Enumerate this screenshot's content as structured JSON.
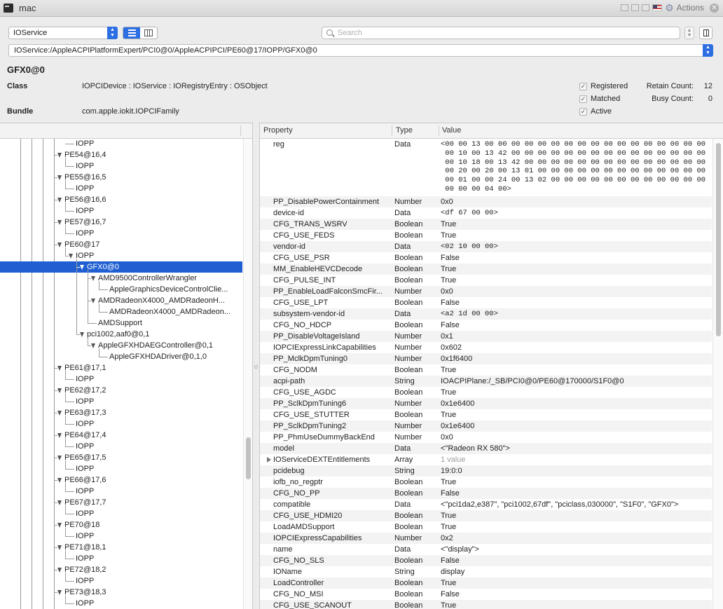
{
  "window": {
    "title": "mac",
    "actions_label": "Actions"
  },
  "toolbar": {
    "class_value": "IOService",
    "search_placeholder": "Search",
    "path": "IOService:/AppleACPIPlatformExpert/PCI0@0/AppleACPIPCI/PE60@17/IOPP/GFX0@0"
  },
  "entry": {
    "name": "GFX0@0",
    "class_label": "Class",
    "class_value": "IOPCIDevice : IOService : IORegistryEntry : OSObject",
    "bundle_label": "Bundle",
    "bundle_value": "com.apple.iokit.IOPCIFamily",
    "flags": [
      {
        "label": "Registered",
        "checked": true
      },
      {
        "label": "Matched",
        "checked": true
      },
      {
        "label": "Active",
        "checked": true
      }
    ],
    "retain_count_label": "Retain Count:",
    "retain_count": "12",
    "busy_count_label": "Busy Count:",
    "busy_count": "0"
  },
  "tree": {
    "rows": [
      {
        "label": "IOPP",
        "level": 5,
        "tri": false
      },
      {
        "label": "PE54@16,4",
        "level": 4,
        "tri": true
      },
      {
        "label": "IOPP",
        "level": 5,
        "tri": false
      },
      {
        "label": "PE55@16,5",
        "level": 4,
        "tri": true
      },
      {
        "label": "IOPP",
        "level": 5,
        "tri": false
      },
      {
        "label": "PE56@16,6",
        "level": 4,
        "tri": true
      },
      {
        "label": "IOPP",
        "level": 5,
        "tri": false
      },
      {
        "label": "PE57@16,7",
        "level": 4,
        "tri": true
      },
      {
        "label": "IOPP",
        "level": 5,
        "tri": false
      },
      {
        "label": "PE60@17",
        "level": 4,
        "tri": true
      },
      {
        "label": "IOPP",
        "level": 5,
        "tri": true
      },
      {
        "label": "GFX0@0",
        "level": 6,
        "tri": true,
        "selected": true
      },
      {
        "label": "AMD9500ControllerWrangler",
        "level": 7,
        "tri": true
      },
      {
        "label": "AppleGraphicsDeviceControlClie...",
        "level": 8,
        "tri": false
      },
      {
        "label": "AMDRadeonX4000_AMDRadeonH...",
        "level": 7,
        "tri": true
      },
      {
        "label": "AMDRadeonX4000_AMDRadeon...",
        "level": 8,
        "tri": false
      },
      {
        "label": "AMDSupport",
        "level": 7,
        "tri": false
      },
      {
        "label": "pci1002,aaf0@0,1",
        "level": 6,
        "tri": true
      },
      {
        "label": "AppleGFXHDAEGController@0,1",
        "level": 7,
        "tri": true
      },
      {
        "label": "AppleGFXHDADriver@0,1,0",
        "level": 8,
        "tri": false
      },
      {
        "label": "PE61@17,1",
        "level": 4,
        "tri": true
      },
      {
        "label": "IOPP",
        "level": 5,
        "tri": false
      },
      {
        "label": "PE62@17,2",
        "level": 4,
        "tri": true
      },
      {
        "label": "IOPP",
        "level": 5,
        "tri": false
      },
      {
        "label": "PE63@17,3",
        "level": 4,
        "tri": true
      },
      {
        "label": "IOPP",
        "level": 5,
        "tri": false
      },
      {
        "label": "PE64@17,4",
        "level": 4,
        "tri": true
      },
      {
        "label": "IOPP",
        "level": 5,
        "tri": false
      },
      {
        "label": "PE65@17,5",
        "level": 4,
        "tri": true
      },
      {
        "label": "IOPP",
        "level": 5,
        "tri": false
      },
      {
        "label": "PE66@17,6",
        "level": 4,
        "tri": true
      },
      {
        "label": "IOPP",
        "level": 5,
        "tri": false
      },
      {
        "label": "PE67@17,7",
        "level": 4,
        "tri": true
      },
      {
        "label": "IOPP",
        "level": 5,
        "tri": false
      },
      {
        "label": "PE70@18",
        "level": 4,
        "tri": true
      },
      {
        "label": "IOPP",
        "level": 5,
        "tri": false
      },
      {
        "label": "PE71@18,1",
        "level": 4,
        "tri": true
      },
      {
        "label": "IOPP",
        "level": 5,
        "tri": false
      },
      {
        "label": "PE72@18,2",
        "level": 4,
        "tri": true
      },
      {
        "label": "IOPP",
        "level": 5,
        "tri": false
      },
      {
        "label": "PE73@18,3",
        "level": 4,
        "tri": true
      },
      {
        "label": "IOPP",
        "level": 5,
        "tri": false
      }
    ]
  },
  "properties": {
    "headers": {
      "property": "Property",
      "type": "Type",
      "value": "Value"
    },
    "reg": {
      "key": "reg",
      "type": "Data",
      "value": "<00 00 13 00 00 00 00 00 00 00 00 00 00 00 00 00 00 00 00 00\n 00 10 00 13 42 00 00 00 00 00 00 00 00 00 00 00 00 00 00 00\n 00 10 18 00 13 42 00 00 00 00 00 00 00 00 00 00 00 00 00 00\n 00 20 00 20 00 13 01 00 00 00 00 00 00 00 00 00 00 00 00 00\n 00 01 00 00 24 00 13 02 00 00 00 00 00 00 00 00 00 00 00 00\n 00 00 00 04 00>"
    },
    "rows": [
      {
        "key": "PP_DisablePowerContainment",
        "type": "Number",
        "value": "0x0"
      },
      {
        "key": "device-id",
        "type": "Data",
        "value": "<df 67 00 00>",
        "mono": true
      },
      {
        "key": "CFG_TRANS_WSRV",
        "type": "Boolean",
        "value": "True"
      },
      {
        "key": "CFG_USE_FEDS",
        "type": "Boolean",
        "value": "True"
      },
      {
        "key": "vendor-id",
        "type": "Data",
        "value": "<02 10 00 00>",
        "mono": true
      },
      {
        "key": "CFG_USE_PSR",
        "type": "Boolean",
        "value": "False"
      },
      {
        "key": "MM_EnableHEVCDecode",
        "type": "Boolean",
        "value": "True"
      },
      {
        "key": "CFG_PULSE_INT",
        "type": "Boolean",
        "value": "True"
      },
      {
        "key": "PP_EnableLoadFalconSmcFir...",
        "type": "Number",
        "value": "0x0"
      },
      {
        "key": "CFG_USE_LPT",
        "type": "Boolean",
        "value": "False"
      },
      {
        "key": "subsystem-vendor-id",
        "type": "Data",
        "value": "<a2 1d 00 00>",
        "mono": true
      },
      {
        "key": "CFG_NO_HDCP",
        "type": "Boolean",
        "value": "False"
      },
      {
        "key": "PP_DisableVoltageIsland",
        "type": "Number",
        "value": "0x1"
      },
      {
        "key": "IOPCIExpressLinkCapabilities",
        "type": "Number",
        "value": "0x602"
      },
      {
        "key": "PP_MclkDpmTuning0",
        "type": "Number",
        "value": "0x1f6400"
      },
      {
        "key": "CFG_NODM",
        "type": "Boolean",
        "value": "True"
      },
      {
        "key": "acpi-path",
        "type": "String",
        "value": "IOACPIPlane:/_SB/PCI0@0/PE60@170000/S1F0@0"
      },
      {
        "key": "CFG_USE_AGDC",
        "type": "Boolean",
        "value": "True"
      },
      {
        "key": "PP_SclkDpmTuning6",
        "type": "Number",
        "value": "0x1e6400"
      },
      {
        "key": "CFG_USE_STUTTER",
        "type": "Boolean",
        "value": "True"
      },
      {
        "key": "PP_SclkDpmTuning2",
        "type": "Number",
        "value": "0x1e6400"
      },
      {
        "key": "PP_PhmUseDummyBackEnd",
        "type": "Number",
        "value": "0x0"
      },
      {
        "key": "model",
        "type": "Data",
        "value": "<\"Radeon RX 580\">"
      },
      {
        "key": "IOServiceDEXTEntitlements",
        "type": "Array",
        "value": "1 value",
        "dim": true,
        "expand": true
      },
      {
        "key": "pcidebug",
        "type": "String",
        "value": "19:0:0"
      },
      {
        "key": "iofb_no_regptr",
        "type": "Boolean",
        "value": "True"
      },
      {
        "key": "CFG_NO_PP",
        "type": "Boolean",
        "value": "False"
      },
      {
        "key": "compatible",
        "type": "Data",
        "value": "<\"pci1da2,e387\", \"pci1002,67df\", \"pciclass,030000\", \"S1F0\", \"GFX0\">"
      },
      {
        "key": "CFG_USE_HDMI20",
        "type": "Boolean",
        "value": "True"
      },
      {
        "key": "LoadAMDSupport",
        "type": "Boolean",
        "value": "True"
      },
      {
        "key": "IOPCIExpressCapabilities",
        "type": "Number",
        "value": "0x2"
      },
      {
        "key": "name",
        "type": "Data",
        "value": "<\"display\">"
      },
      {
        "key": "CFG_NO_SLS",
        "type": "Boolean",
        "value": "False"
      },
      {
        "key": "IOName",
        "type": "String",
        "value": "display"
      },
      {
        "key": "LoadController",
        "type": "Boolean",
        "value": "True"
      },
      {
        "key": "CFG_NO_MSI",
        "type": "Boolean",
        "value": "False"
      },
      {
        "key": "CFG_USE_SCANOUT",
        "type": "Boolean",
        "value": "True"
      }
    ]
  }
}
